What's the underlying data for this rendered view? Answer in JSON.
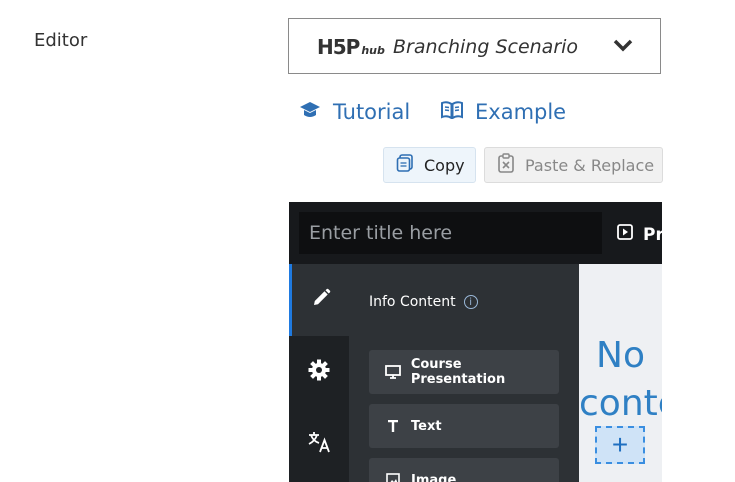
{
  "field": {
    "label": "Editor"
  },
  "selector": {
    "logo_big": "H5P",
    "logo_hub": "hub",
    "title": "Branching Scenario",
    "chevron": "chevron-down-icon"
  },
  "links": {
    "tutorial": "Tutorial",
    "example": "Example"
  },
  "buttons": {
    "copy": "Copy",
    "paste": "Paste & Replace"
  },
  "editor": {
    "title_placeholder": "Enter title here",
    "preview_label": "Pr",
    "panel_title": "Info Content",
    "content_types": [
      "Course Presentation",
      "Text",
      "Image"
    ],
    "canvas_text": [
      "No",
      "conte"
    ],
    "add_label": "+"
  },
  "colors": {
    "link": "#2f6fb3",
    "accent": "#1f7ae0",
    "canvas_text": "#2f80c4"
  }
}
